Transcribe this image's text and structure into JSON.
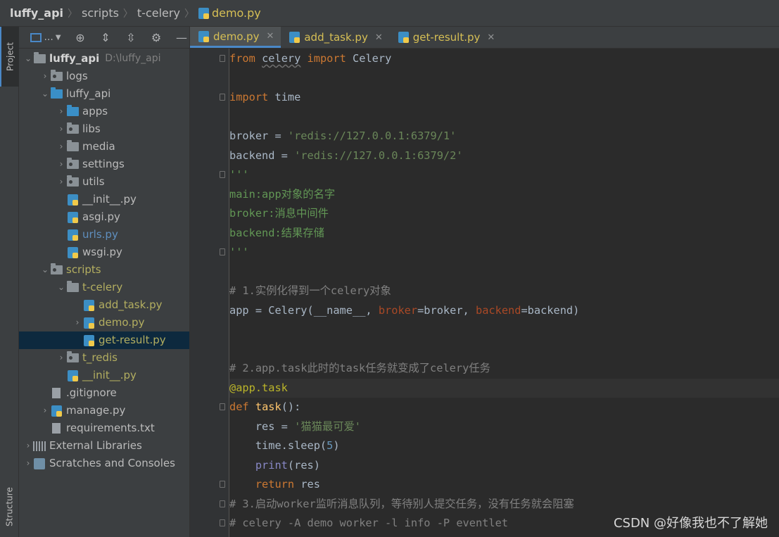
{
  "breadcrumb": {
    "project": "luffy_api",
    "folder1": "scripts",
    "folder2": "t-celery",
    "file": "demo.py"
  },
  "toolwindows": {
    "project": "Project",
    "structure": "Structure"
  },
  "project_panel": {
    "view_selector": "..."
  },
  "tree": {
    "root": {
      "label": "luffy_api",
      "path": "D:\\luffy_api"
    },
    "items": [
      "logs",
      "luffy_api",
      "apps",
      "libs",
      "media",
      "settings",
      "utils",
      "__init__.py",
      "asgi.py",
      "urls.py",
      "wsgi.py",
      "scripts",
      "t-celery",
      "add_task.py",
      "demo.py",
      "get-result.py",
      "t_redis",
      "__init__.py",
      ".gitignore",
      "manage.py",
      "requirements.txt",
      "External Libraries",
      "Scratches and Consoles"
    ]
  },
  "tabs": [
    {
      "label": "demo.py"
    },
    {
      "label": "add_task.py"
    },
    {
      "label": "get-result.py"
    }
  ],
  "code": {
    "l1_from": "from",
    "l1_mod": "celery",
    "l1_import": "import",
    "l1_name": "Celery",
    "l3_import": "import",
    "l3_mod": "time",
    "l5_a": "broker = ",
    "l5_s": "'redis://127.0.0.1:6379/1'",
    "l6_a": "backend = ",
    "l6_s": "'redis://127.0.0.1:6379/2'",
    "l7": "'''",
    "l8": "main:app对象的名字",
    "l9": "broker:消息中间件",
    "l10": "backend:结果存储",
    "l11": "'''",
    "l13": "# 1.实例化得到一个celery对象",
    "l14_a": "app = Celery(__name__, ",
    "l14_p1": "broker",
    "l14_b": "=broker, ",
    "l14_p2": "backend",
    "l14_c": "=backend)",
    "l17": "# 2.app.task此时的task任务就变成了celery任务",
    "l18": "@app.task",
    "l19_def": "def",
    "l19_name": "task",
    "l19_rest": "():",
    "l20_a": "    res = ",
    "l20_s": "'猫猫最可爱'",
    "l21_a": "    time.sleep(",
    "l21_n": "5",
    "l21_b": ")",
    "l22_a": "    ",
    "l22_p": "print",
    "l22_b": "(res)",
    "l23_a": "    ",
    "l23_kw": "return",
    "l23_b": " res",
    "l24": "# 3.启动worker监听消息队列，等待别人提交任务，没有任务就会阻塞",
    "l25": "# celery -A demo worker -l info -P eventlet"
  },
  "watermark": "CSDN @好像我也不了解她"
}
